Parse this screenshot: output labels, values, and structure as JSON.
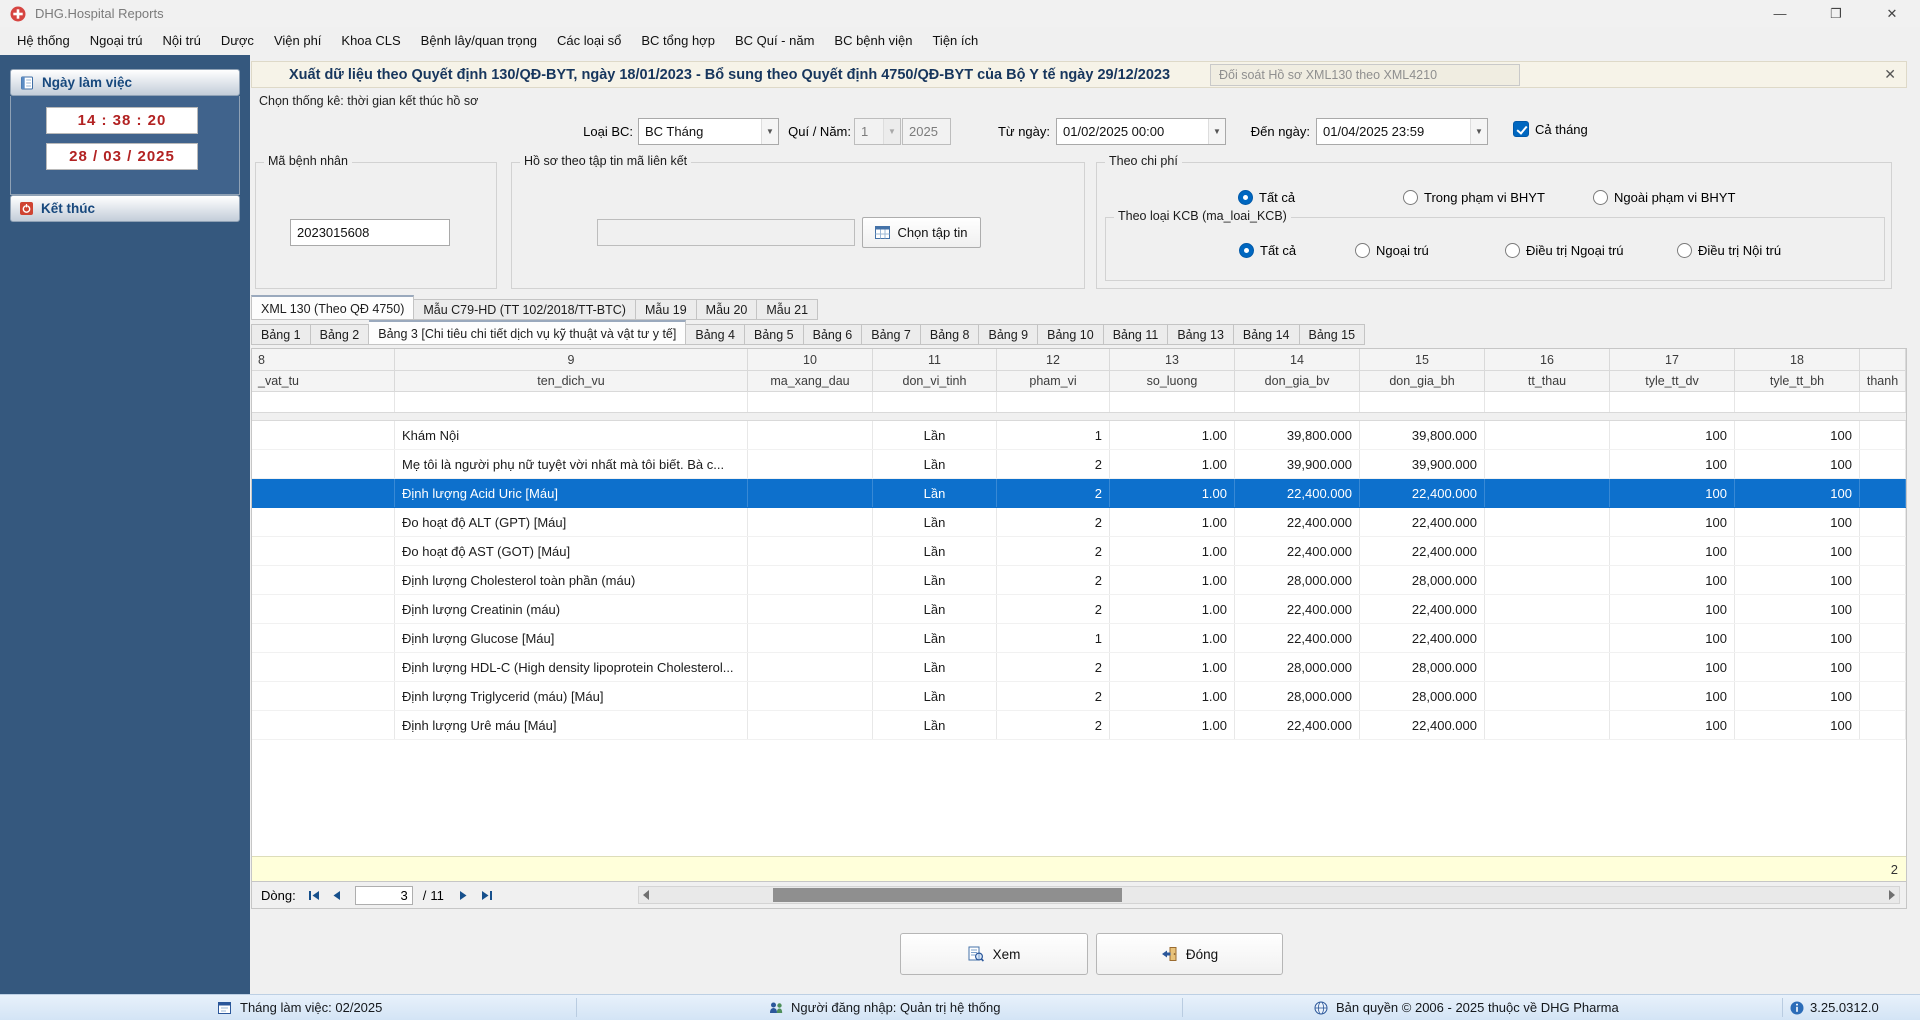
{
  "window": {
    "title": "DHG.Hospital Reports"
  },
  "icons": {
    "minimize": "—",
    "maximize": "❐",
    "close": "✕",
    "tab_close": "✕",
    "combo_arrow": "▼"
  },
  "menu": {
    "items": [
      "Hệ thống",
      "Ngoại trú",
      "Nội trú",
      "Dược",
      "Viện phí",
      "Khoa CLS",
      "Bệnh lây/quan trọng",
      "Các loại sổ",
      "BC tổng hợp",
      "BC Quí - năm",
      "BC bệnh viện",
      "Tiện ích"
    ]
  },
  "sidebar": {
    "calendar_title": "Ngày làm việc",
    "time": "14 : 38 : 20",
    "date": "28 / 03 / 2025",
    "end_button": "Kết thúc"
  },
  "header": {
    "title": "Xuất dữ liệu theo Quyết định 130/QĐ-BYT, ngày 18/01/2023 - Bổ sung theo Quyết định 4750/QĐ-BYT của Bộ Y tế ngày 29/12/2023",
    "secondary_tab": "Đối soát Hồ sơ XML130 theo XML4210"
  },
  "filters": {
    "hint": "Chọn thống kê: thời gian kết thúc hồ sơ",
    "loai_bc_label": "Loại BC:",
    "loai_bc_value": "BC Tháng",
    "qui_nam_label": "Quí / Năm:",
    "qui_value": "1",
    "nam_value": "2025",
    "tu_ngay_label": "Từ ngày:",
    "tu_ngay_value": "01/02/2025 00:00",
    "den_ngay_label": "Đến ngày:",
    "den_ngay_value": "01/04/2025 23:59",
    "ca_thang_label": "Cả tháng",
    "ca_thang_checked": true,
    "ma_benh_nhan_label": "Mã bệnh nhân",
    "ma_benh_nhan_value": "2023015608",
    "ho_so_label": "Hồ sơ theo tập tin mã liên kết",
    "ho_so_value": "",
    "chon_tap_tin_label": "Chọn tập tin",
    "theo_chi_phi_label": "Theo chi phí",
    "chi_phi_options": [
      {
        "label": "Tất cả",
        "selected": true
      },
      {
        "label": "Trong phạm vi BHYT",
        "selected": false
      },
      {
        "label": "Ngoài phạm vi BHYT",
        "selected": false
      }
    ],
    "theo_loai_kcb_label": "Theo loại KCB (ma_loai_KCB)",
    "kcb_options": [
      {
        "label": "Tất cả",
        "selected": true
      },
      {
        "label": "Ngoại trú",
        "selected": false
      },
      {
        "label": "Điều trị Ngoại trú",
        "selected": false
      },
      {
        "label": "Điều trị Nội trú",
        "selected": false
      }
    ]
  },
  "tabs": {
    "primary": [
      {
        "label": "XML 130 (Theo QĐ 4750)",
        "selected": true
      },
      {
        "label": "Mẫu C79-HD (TT 102/2018/TT-BTC)",
        "selected": false
      },
      {
        "label": "Mẫu 19",
        "selected": false
      },
      {
        "label": "Mẫu 20",
        "selected": false
      },
      {
        "label": "Mẫu 21",
        "selected": false
      }
    ],
    "secondary": [
      {
        "label": "Bảng 1",
        "selected": false
      },
      {
        "label": "Bảng 2",
        "selected": false
      },
      {
        "label": "Bảng 3 [Chi tiêu chi tiết dịch vụ kỹ thuật và vật tư y tế]",
        "selected": true
      },
      {
        "label": "Bảng 4",
        "selected": false
      },
      {
        "label": "Bảng 5",
        "selected": false
      },
      {
        "label": "Bảng 6",
        "selected": false
      },
      {
        "label": "Bảng 7",
        "selected": false
      },
      {
        "label": "Bảng 8",
        "selected": false
      },
      {
        "label": "Bảng 9",
        "selected": false
      },
      {
        "label": "Bảng 10",
        "selected": false
      },
      {
        "label": "Bảng 11",
        "selected": false
      },
      {
        "label": "Bảng 13",
        "selected": false
      },
      {
        "label": "Bảng 14",
        "selected": false
      },
      {
        "label": "Bảng 15",
        "selected": false
      }
    ]
  },
  "grid": {
    "column_numbers": [
      "8",
      "9",
      "10",
      "11",
      "12",
      "13",
      "14",
      "15",
      "16",
      "17",
      "18",
      ""
    ],
    "column_names": [
      "_vat_tu",
      "ten_dich_vu",
      "ma_xang_dau",
      "don_vi_tinh",
      "pham_vi",
      "so_luong",
      "don_gia_bv",
      "don_gia_bh",
      "tt_thau",
      "tyle_tt_dv",
      "tyle_tt_bh",
      "thanh"
    ],
    "selected_row": 2,
    "rows": [
      {
        "ten_dich_vu": "Khám Nội",
        "don_vi_tinh": "Lần",
        "pham_vi": "1",
        "so_luong": "1.00",
        "don_gia_bv": "39,800.000",
        "don_gia_bh": "39,800.000",
        "tyle_tt_dv": "100",
        "tyle_tt_bh": "100"
      },
      {
        "ten_dich_vu": "Mẹ tôi là người phụ nữ tuyệt vời nhất mà tôi biết. Bà c...",
        "don_vi_tinh": "Lần",
        "pham_vi": "2",
        "so_luong": "1.00",
        "don_gia_bv": "39,900.000",
        "don_gia_bh": "39,900.000",
        "tyle_tt_dv": "100",
        "tyle_tt_bh": "100"
      },
      {
        "ten_dich_vu": "Định lượng Acid Uric [Máu]",
        "don_vi_tinh": "Lần",
        "pham_vi": "2",
        "so_luong": "1.00",
        "don_gia_bv": "22,400.000",
        "don_gia_bh": "22,400.000",
        "tyle_tt_dv": "100",
        "tyle_tt_bh": "100"
      },
      {
        "ten_dich_vu": "Đo hoạt độ ALT (GPT) [Máu]",
        "don_vi_tinh": "Lần",
        "pham_vi": "2",
        "so_luong": "1.00",
        "don_gia_bv": "22,400.000",
        "don_gia_bh": "22,400.000",
        "tyle_tt_dv": "100",
        "tyle_tt_bh": "100"
      },
      {
        "ten_dich_vu": "Đo hoạt độ AST (GOT) [Máu]",
        "don_vi_tinh": "Lần",
        "pham_vi": "2",
        "so_luong": "1.00",
        "don_gia_bv": "22,400.000",
        "don_gia_bh": "22,400.000",
        "tyle_tt_dv": "100",
        "tyle_tt_bh": "100"
      },
      {
        "ten_dich_vu": "Định lượng Cholesterol toàn phần (máu)",
        "don_vi_tinh": "Lần",
        "pham_vi": "2",
        "so_luong": "1.00",
        "don_gia_bv": "28,000.000",
        "don_gia_bh": "28,000.000",
        "tyle_tt_dv": "100",
        "tyle_tt_bh": "100"
      },
      {
        "ten_dich_vu": "Định lượng Creatinin (máu)",
        "don_vi_tinh": "Lần",
        "pham_vi": "2",
        "so_luong": "1.00",
        "don_gia_bv": "22,400.000",
        "don_gia_bh": "22,400.000",
        "tyle_tt_dv": "100",
        "tyle_tt_bh": "100"
      },
      {
        "ten_dich_vu": "Định lượng Glucose [Máu]",
        "don_vi_tinh": "Lần",
        "pham_vi": "1",
        "so_luong": "1.00",
        "don_gia_bv": "22,400.000",
        "don_gia_bh": "22,400.000",
        "tyle_tt_dv": "100",
        "tyle_tt_bh": "100"
      },
      {
        "ten_dich_vu": "Định lượng HDL-C (High density lipoprotein Cholesterol...",
        "don_vi_tinh": "Lần",
        "pham_vi": "2",
        "so_luong": "1.00",
        "don_gia_bv": "28,000.000",
        "don_gia_bh": "28,000.000",
        "tyle_tt_dv": "100",
        "tyle_tt_bh": "100"
      },
      {
        "ten_dich_vu": "Định lượng Triglycerid (máu) [Máu]",
        "don_vi_tinh": "Lần",
        "pham_vi": "2",
        "so_luong": "1.00",
        "don_gia_bv": "28,000.000",
        "don_gia_bh": "28,000.000",
        "tyle_tt_dv": "100",
        "tyle_tt_bh": "100"
      },
      {
        "ten_dich_vu": "Định lượng Urê máu [Máu]",
        "don_vi_tinh": "Lần",
        "pham_vi": "2",
        "so_luong": "1.00",
        "don_gia_bv": "22,400.000",
        "don_gia_bh": "22,400.000",
        "tyle_tt_dv": "100",
        "tyle_tt_bh": "100"
      }
    ],
    "footer_value": "2"
  },
  "pager": {
    "label": "Dòng:",
    "current": "3",
    "of": "/",
    "total": "11"
  },
  "actions": {
    "view": "Xem",
    "close": "Đóng"
  },
  "statusbar": {
    "working_month": "Tháng làm việc: 02/2025",
    "logged_in": "Người đăng nhập: Quản trị hệ thống",
    "copyright": "Bản quyền © 2006 - 2025 thuộc về DHG Pharma",
    "version": "3.25.0312.0"
  }
}
